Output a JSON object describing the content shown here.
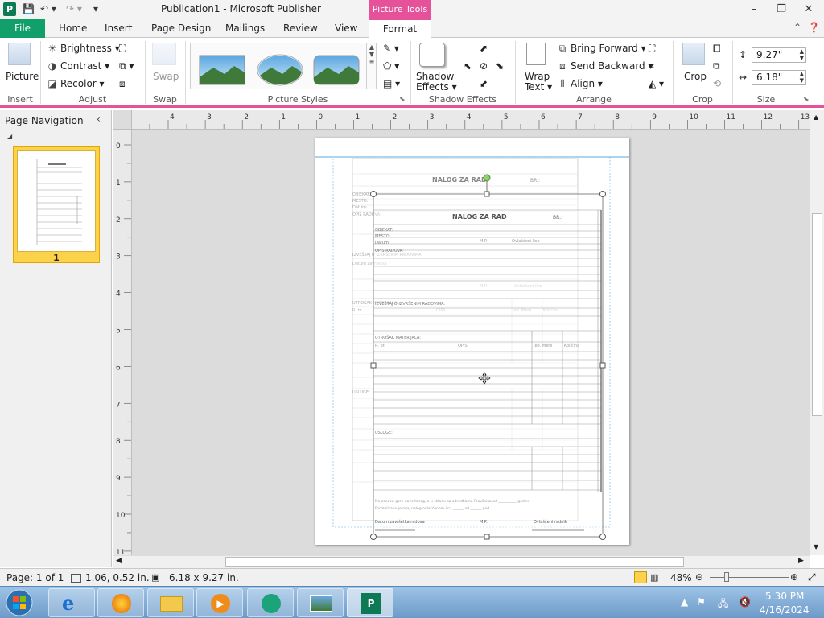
{
  "titlebar": {
    "title": "Publication1 - Microsoft Publisher",
    "contextual_tab": "Picture Tools",
    "minimize": "–",
    "restore": "❐",
    "close": "✕"
  },
  "tabs": {
    "file": "File",
    "home": "Home",
    "insert": "Insert",
    "page_design": "Page Design",
    "mailings": "Mailings",
    "review": "Review",
    "view": "View",
    "format": "Format"
  },
  "ribbon": {
    "insert_group": {
      "picture": "Picture",
      "label": "Insert"
    },
    "adjust_group": {
      "brightness": "Brightness",
      "contrast": "Contrast",
      "recolor": "Recolor",
      "label": "Adjust"
    },
    "swap_group": {
      "swap": "Swap",
      "label": "Swap"
    },
    "picture_styles_group": {
      "label": "Picture Styles"
    },
    "shadow_group": {
      "shadow_effects_line1": "Shadow",
      "shadow_effects_line2": "Effects",
      "label": "Shadow Effects"
    },
    "arrange_group": {
      "wrap_text_line1": "Wrap",
      "wrap_text_line2": "Text",
      "bring_forward": "Bring Forward",
      "send_backward": "Send Backward",
      "align": "Align",
      "label": "Arrange"
    },
    "crop_group": {
      "crop": "Crop",
      "label": "Crop"
    },
    "size_group": {
      "height": "9.27\"",
      "width": "6.18\"",
      "label": "Size"
    }
  },
  "navpane": {
    "title": "Page Navigation",
    "page_number": "1"
  },
  "rulers": {
    "h_ticks": [
      "4",
      "3",
      "2",
      "1",
      "0",
      "1",
      "2",
      "3",
      "4",
      "5",
      "6",
      "7",
      "8",
      "9",
      "10",
      "11",
      "12",
      "13"
    ],
    "v_ticks": [
      "0",
      "1",
      "2",
      "3",
      "4",
      "5",
      "6",
      "7",
      "8",
      "9",
      "10",
      "11"
    ]
  },
  "document": {
    "back_title": "NALOG ZA RAD",
    "back_br": "BR.:",
    "back_fields": [
      "OBJEKAT:",
      "MESTO:",
      "Datum:",
      "OPIS RADOVA:"
    ],
    "back_izvestaj": "IZVEŠTAJ O IZVRŠENIM RADOVIMA:",
    "back_datum_zavrsetka": "Datum završetka",
    "back_mp": "M.P.",
    "back_ovlasceni": "Ovlašćeni lice",
    "back_utrosak": "UTROŠAK MATERIJALA:",
    "back_columns": [
      "R. br.",
      "OPIS",
      "Jed. Mere",
      "Količina"
    ],
    "back_usluge": "USLUGE:",
    "front_title": "NALOG ZA RAD",
    "front_br": "BR.:",
    "front_fields": [
      "OBJEKAT:",
      "MESTO:",
      "Datum:",
      "OPIS RADOVA:"
    ],
    "front_mp": "M.P.",
    "front_ovlasceni": "Ovlašćeni lice",
    "front_izvestaj": "IZVEŠTAJ O IZVRŠENIM RADOVIMA:",
    "front_utrosak": "UTROŠAK MATERIJALA:",
    "front_columns": [
      "R. br.",
      "OPIS",
      "Jed. Mere",
      "Količina"
    ],
    "front_usluge": "USLUGE:",
    "front_footer_line1": "Na osnovu gore navedenog, a u skladu sa odredbama Pravilnika od __________ godine",
    "front_footer_line2": "Formulisano je ovaj nalog ovlašćenom licu ______ od ______ god.",
    "front_datum_zavrsetka": "Datum završetka radova",
    "front_ovlasceni_radnik": "Ovlašćeni radnik"
  },
  "statusbar": {
    "page": "Page: 1 of 1",
    "position": "1.06, 0.52 in.",
    "size": "6.18 x 9.27 in.",
    "zoom": "48%"
  },
  "taskbar": {
    "time": "5:30 PM",
    "date": "4/16/2024"
  }
}
